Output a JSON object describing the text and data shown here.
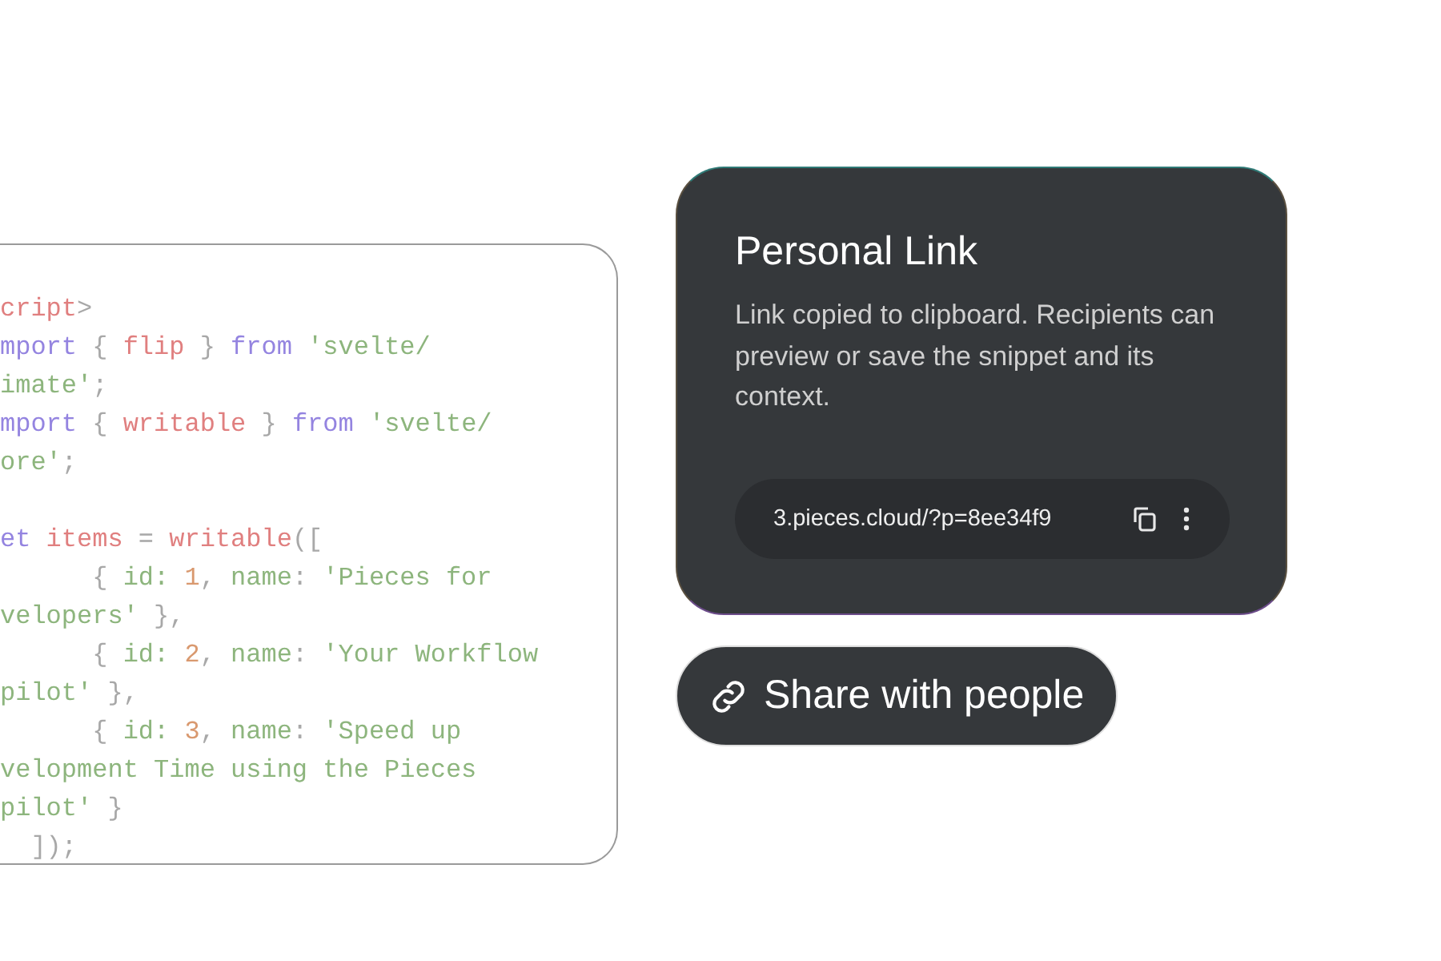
{
  "code_panel": {
    "blocks": [
      [
        {
          "tokens": [
            {
              "text": "cript",
              "kind": "tag"
            },
            {
              "text": ">",
              "kind": "punct"
            }
          ]
        },
        {
          "tokens": [
            {
              "text": "mport",
              "kind": "keyword"
            },
            {
              "text": " { ",
              "kind": "punct"
            },
            {
              "text": "flip",
              "kind": "tag"
            },
            {
              "text": " } ",
              "kind": "punct"
            },
            {
              "text": "from",
              "kind": "keyword"
            },
            {
              "text": " 'svelte/",
              "kind": "string"
            }
          ]
        },
        {
          "tokens": [
            {
              "text": "imate'",
              "kind": "string"
            },
            {
              "text": ";",
              "kind": "punct"
            }
          ]
        },
        {
          "tokens": [
            {
              "text": "mport",
              "kind": "keyword"
            },
            {
              "text": " { ",
              "kind": "punct"
            },
            {
              "text": "writable",
              "kind": "tag"
            },
            {
              "text": " } ",
              "kind": "punct"
            },
            {
              "text": "from",
              "kind": "keyword"
            },
            {
              "text": " 'svelte/",
              "kind": "string"
            }
          ]
        },
        {
          "tokens": [
            {
              "text": "ore'",
              "kind": "string"
            },
            {
              "text": ";",
              "kind": "punct"
            }
          ]
        }
      ],
      [
        {
          "tokens": [
            {
              "text": "et",
              "kind": "keyword"
            },
            {
              "text": " items",
              "kind": "tag"
            },
            {
              "text": " = ",
              "kind": "punct"
            },
            {
              "text": "writable",
              "kind": "tag"
            },
            {
              "text": "([",
              "kind": "punct"
            }
          ]
        },
        {
          "tokens": [
            {
              "text": "      { ",
              "kind": "punct"
            },
            {
              "text": "id:",
              "kind": "string"
            },
            {
              "text": " 1",
              "kind": "number"
            },
            {
              "text": ", ",
              "kind": "punct"
            },
            {
              "text": "name",
              "kind": "string"
            },
            {
              "text": ": ",
              "kind": "punct"
            },
            {
              "text": "'Pieces for",
              "kind": "string"
            }
          ]
        },
        {
          "tokens": [
            {
              "text": "velopers'",
              "kind": "string"
            },
            {
              "text": " },",
              "kind": "punct"
            }
          ]
        },
        {
          "tokens": [
            {
              "text": "      { ",
              "kind": "punct"
            },
            {
              "text": "id:",
              "kind": "string"
            },
            {
              "text": " 2",
              "kind": "number"
            },
            {
              "text": ", ",
              "kind": "punct"
            },
            {
              "text": "name",
              "kind": "string"
            },
            {
              "text": ": ",
              "kind": "punct"
            },
            {
              "text": "'Your Workflow",
              "kind": "string"
            }
          ]
        },
        {
          "tokens": [
            {
              "text": "pilot'",
              "kind": "string"
            },
            {
              "text": " },",
              "kind": "punct"
            }
          ]
        },
        {
          "tokens": [
            {
              "text": "      { ",
              "kind": "punct"
            },
            {
              "text": "id:",
              "kind": "string"
            },
            {
              "text": " 3",
              "kind": "number"
            },
            {
              "text": ", ",
              "kind": "punct"
            },
            {
              "text": "name",
              "kind": "string"
            },
            {
              "text": ": ",
              "kind": "punct"
            },
            {
              "text": "'Speed up",
              "kind": "string"
            }
          ]
        },
        {
          "tokens": [
            {
              "text": "velopment Time using the Pieces",
              "kind": "string"
            }
          ]
        },
        {
          "tokens": [
            {
              "text": "pilot'",
              "kind": "string"
            },
            {
              "text": " }",
              "kind": "punct"
            }
          ]
        },
        {
          "tokens": [
            {
              "text": "  ]);",
              "kind": "punct"
            }
          ]
        }
      ]
    ]
  },
  "share_card": {
    "title": "Personal Link",
    "message": "Link copied to clipboard. Recipients can preview or save the snippet and its context.",
    "link": "3.pieces.cloud/?p=8ee34f9"
  },
  "share_button": {
    "label": "Share with people"
  }
}
